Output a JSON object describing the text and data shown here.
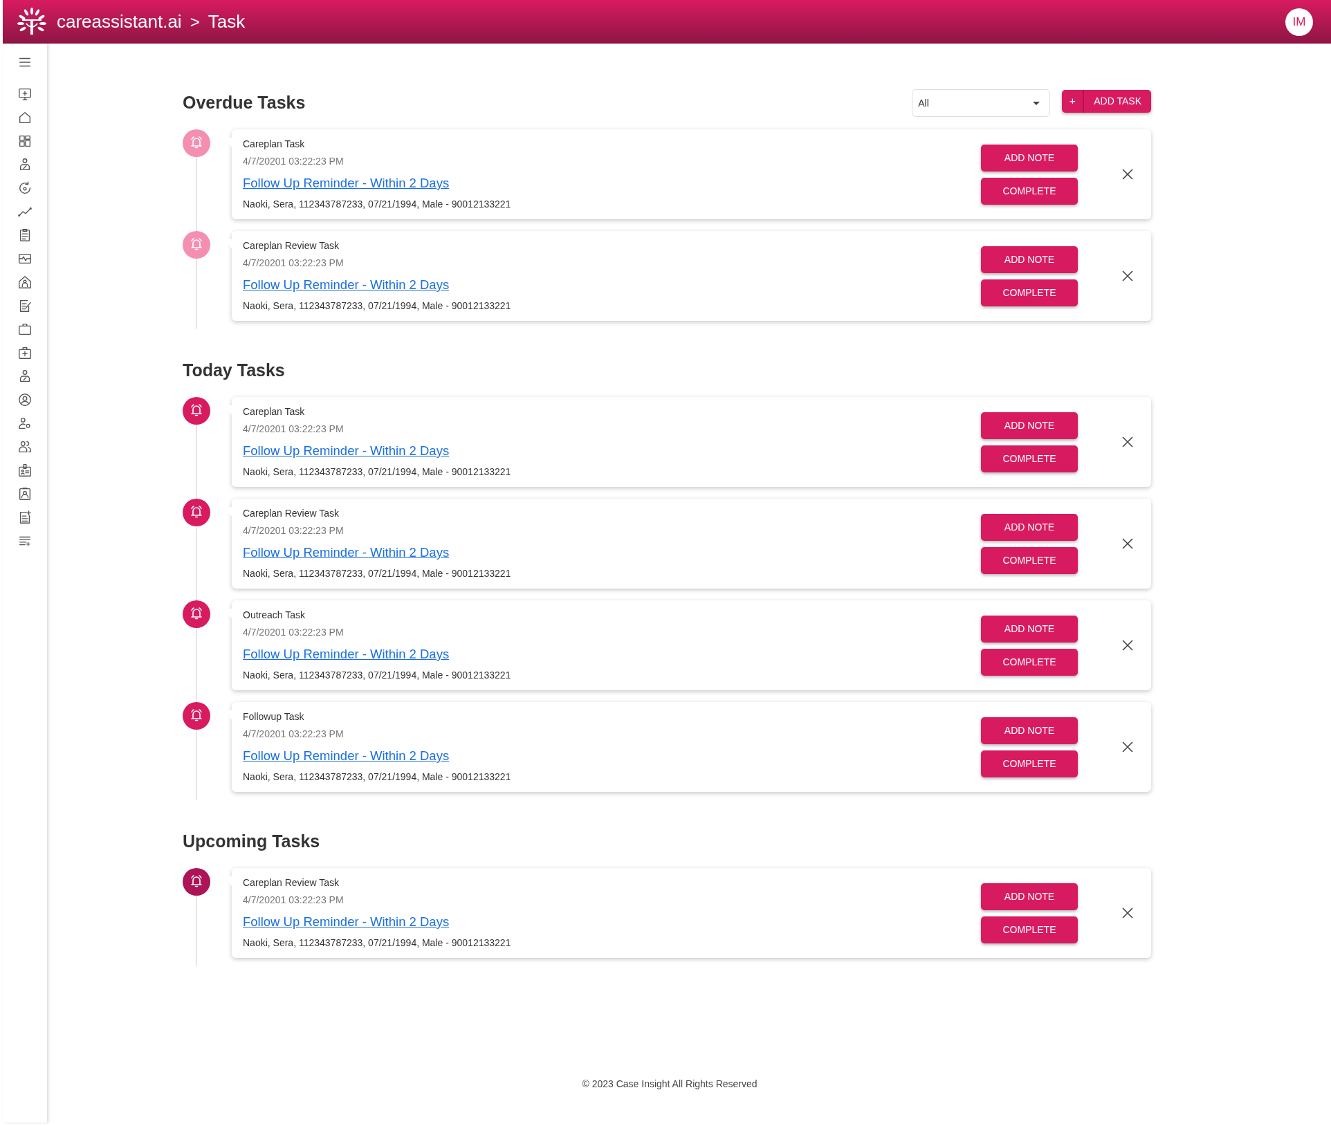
{
  "header": {
    "brand": "careassistant.ai",
    "separator": ">",
    "page": "Task",
    "avatar": "IM"
  },
  "filter": {
    "value": "All"
  },
  "add_task": {
    "icon": "+",
    "label": "ADD TASK"
  },
  "sections": [
    {
      "title": "Overdue Tasks",
      "tasks": [
        {
          "type": "Careplan Task",
          "date": "4/7/20201 03:22:23 PM",
          "link": "Follow Up Reminder - Within 2 Days",
          "details": "Naoki, Sera, 112343787233, 07/21/1994, Male - 90012133221",
          "color": "#f48fb1",
          "buttons": [
            "ADD NOTE",
            "COMPLETE"
          ]
        },
        {
          "type": "Careplan Review Task",
          "date": "4/7/20201 03:22:23 PM",
          "link": "Follow Up Reminder - Within 2 Days",
          "details": "Naoki, Sera, 112343787233, 07/21/1994, Male - 90012133221",
          "color": "#f48fb1",
          "buttons": [
            "ADD NOTE",
            "COMPLETE"
          ]
        }
      ]
    },
    {
      "title": "Today Tasks",
      "tasks": [
        {
          "type": "Careplan Task",
          "date": "4/7/20201 03:22:23 PM",
          "link": "Follow Up Reminder - Within 2 Days",
          "details": "Naoki, Sera, 112343787233, 07/21/1994, Male - 90012133221",
          "color": "#d81b60",
          "buttons": [
            "ADD NOTE",
            "COMPLETE"
          ]
        },
        {
          "type": "Careplan Review Task",
          "date": "4/7/20201 03:22:23 PM",
          "link": "Follow Up Reminder - Within 2 Days",
          "details": "Naoki, Sera, 112343787233, 07/21/1994, Male - 90012133221",
          "color": "#d81b60",
          "buttons": [
            "ADD NOTE",
            "COMPLETE"
          ]
        },
        {
          "type": "Outreach Task",
          "date": "4/7/20201 03:22:23 PM",
          "link": "Follow Up Reminder - Within 2 Days",
          "details": "Naoki, Sera, 112343787233, 07/21/1994, Male - 90012133221",
          "color": "#d81b60",
          "buttons": [
            "ADD NOTE",
            "COMPLETE"
          ]
        },
        {
          "type": "Followup Task",
          "date": "4/7/20201 03:22:23 PM",
          "link": "Follow Up Reminder - Within 2 Days",
          "details": "Naoki, Sera, 112343787233, 07/21/1994, Male - 90012133221",
          "color": "#d81b60",
          "buttons": [
            "ADD NOTE",
            "COMPLETE"
          ]
        }
      ]
    },
    {
      "title": "Upcoming Tasks",
      "tasks": [
        {
          "type": "Careplan Review Task",
          "date": "4/7/20201 03:22:23 PM",
          "link": "Follow Up Reminder - Within 2 Days",
          "details": "Naoki, Sera, 112343787233, 07/21/1994, Male - 90012133221",
          "color": "#ad1457",
          "buttons": [
            "ADD NOTE",
            "COMPLETE"
          ]
        }
      ]
    }
  ],
  "footer": "© 2023 Case Insight All Rights Reserved"
}
